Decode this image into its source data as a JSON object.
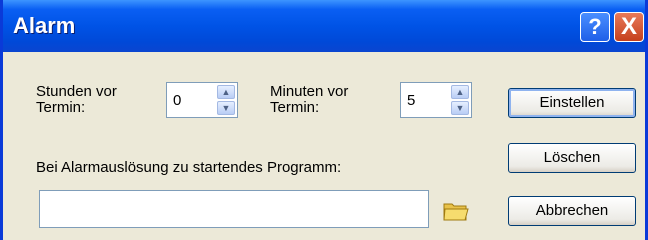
{
  "window": {
    "title": "Alarm",
    "help_label": "?",
    "close_label": "X"
  },
  "fields": {
    "hours_label_line1": "Stunden vor",
    "hours_label_line2": "Termin:",
    "hours_value": "0",
    "minutes_label_line1": "Minuten vor",
    "minutes_label_line2": "Termin:",
    "minutes_value": "5",
    "program_label": "Bei Alarmauslösung zu startendes Programm:",
    "program_value": ""
  },
  "buttons": {
    "set": "Einstellen",
    "delete": "Löschen",
    "cancel": "Abbrechen"
  },
  "icons": {
    "spinner_up": "▲",
    "spinner_down": "▼"
  },
  "colors": {
    "title_bar": "#0053e6",
    "window_bg": "#ece9d8"
  }
}
